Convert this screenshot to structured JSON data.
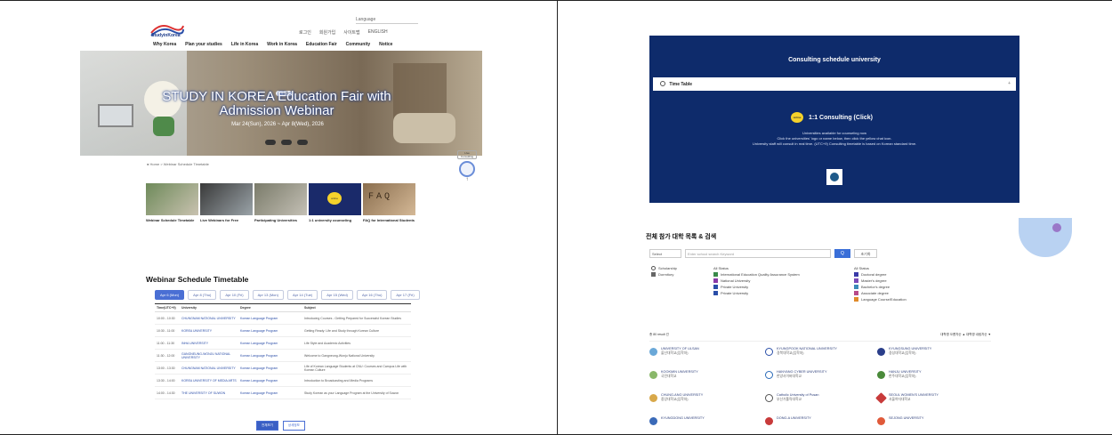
{
  "left": {
    "logo_text": "StudyinKorea",
    "lang_label": "Language",
    "util_links": [
      "로그인",
      "회원가입",
      "사이트맵",
      "ENGLISH"
    ],
    "gnb": [
      "Why Korea",
      "Plan your studies",
      "Life in Korea",
      "Work in Korea",
      "Education Fair",
      "Community",
      "Notice"
    ],
    "hero": {
      "badge": "● 알림",
      "title": "STUDY IN KOREA Education Fair with Admission Webinar",
      "date": "Mar 24(Sun), 2026 ~ Apr 8(Wed), 2026"
    },
    "breadcrumb": "Home  >  Webinar Schedule Timetable",
    "side_widget": {
      "label": "Live Consulting",
      "up": "↑"
    },
    "cards": [
      {
        "caption": "Webinar Schedule Timetable"
      },
      {
        "caption": "Live Webinars for Free"
      },
      {
        "caption": "Participating Universities"
      },
      {
        "caption": "1:1 university counseling",
        "badge": "online"
      },
      {
        "caption": "FAQ for International Students",
        "faq": "FAQ"
      }
    ],
    "section_title": "Webinar Schedule Timetable",
    "date_tabs": [
      "Apr 6 (Mon)",
      "Apr 8 (Thu)",
      "Apr 10 (Fri)",
      "Apr 13 (Mon)",
      "Apr 14 (Tue)",
      "Apr 15 (Wed)",
      "Apr 16 (Thu)",
      "Apr 17 (Fri)"
    ],
    "table": {
      "headers": [
        "Time(UTC+9)",
        "University",
        "Degree",
        "Subject"
      ],
      "rows": [
        [
          "10:00 - 10:30",
          "CHUNGNAM NATIONAL UNIVERSITY",
          "Korean Language Program",
          "Introducing Courses - Getting Prepared for Successful Korean Studies"
        ],
        [
          "10:30 - 11:00",
          "KOREA UNIVERSITY",
          "Korean Language Program",
          "Getting Ready: Life and Study through Korean Culture"
        ],
        [
          "11:00 - 11:30",
          "INHA UNIVERSITY",
          "Korean Language Program",
          "Life Style and Academic Activities"
        ],
        [
          "11:30 - 12:00",
          "GANGNEUNG-WONJU NATIONAL UNIVERSITY",
          "Korean Language Program",
          "Welcome to Gangneung-Wonju National University"
        ],
        [
          "13:00 - 13:30",
          "CHUNGNAM NATIONAL UNIVERSITY",
          "Korean Language Program",
          "Life of Korean Language Students at CNU: Courses and Campus Life with Korean Culture"
        ],
        [
          "13:30 - 14:00",
          "KOREA UNIVERSITY OF MEDIA ARTS",
          "Korean Language Program",
          "Introduction to Broadcasting and Media Programs"
        ],
        [
          "14:00 - 14:30",
          "THE UNIVERSITY OF SUWON",
          "Korean Language Program",
          "Study Korean as your Language Program at the University of Suwon"
        ]
      ]
    },
    "table_buttons": [
      "전체보기",
      "상세정보"
    ]
  },
  "right": {
    "consult_title": "Consulting schedule university",
    "timetable_label": "Time Table",
    "consult_button": "1:1 Consulting (Click)",
    "consult_bubble": "online",
    "consult_desc": [
      "Universities available for counseling now",
      "Click the universities' logo or name below, then click the yellow chat icon.",
      "University staff will consult in real time. (UTC+9) Consulting timetable is based on Korean standard time."
    ],
    "list_title": "전체 참가 대학 목록 & 검색",
    "search": {
      "select": "Select",
      "placeholder": "Enter school search Keyword",
      "button": "Q",
      "reset": "초기화"
    },
    "filters": {
      "col1": [
        "Scholarship",
        "Dormitory"
      ],
      "col2": [
        "All Status",
        "International Education Quality Assurance System",
        "National University",
        "Private University",
        "Private University"
      ],
      "col3": [
        "All Status",
        "Doctoral degree",
        "Master's degree",
        "Bachelor's degree",
        "Associate degree",
        "Language Course/Education"
      ]
    },
    "count_label": "총 80 result 건",
    "sort_options": "대학명 오름차순 ▲   대학명 내림차순 ▼",
    "universities": [
      {
        "en": "UNIVERSITY OF ULSAN",
        "kr": "울산대학교(입학처)"
      },
      {
        "en": "KYUNGPOOK NATIONAL UNIVERSITY",
        "kr": "경북대학교(입학처)"
      },
      {
        "en": "KYUNGSUNG UNIVERSITY",
        "kr": "경성대학교(입학처)"
      },
      {
        "en": "KOOKMIN UNIVERSITY",
        "kr": "국민대학교"
      },
      {
        "en": "HANYANG CYBER UNIVERSITY",
        "kr": "한양사이버대학교"
      },
      {
        "en": "HANJU UNIVERSITY",
        "kr": "한주대학교(입학처)"
      },
      {
        "en": "CHUNG-ANG UNIVERSITY",
        "kr": "중앙대학교(입학처)"
      },
      {
        "en": "Catholic University of Pusan",
        "kr": "부산가톨릭대학교"
      },
      {
        "en": "SEOUL WOMEN'S UNIVERSITY",
        "kr": "서울여자대학교"
      },
      {
        "en": "KYUNGDONG UNIVERSITY",
        "kr": ""
      },
      {
        "en": "DONG-A UNIVERSITY",
        "kr": ""
      },
      {
        "en": "SEJONG UNIVERSITY",
        "kr": ""
      }
    ],
    "colors": {
      "navy": "#0e2b6b",
      "accent": "#3a6fd8",
      "yellow": "#f5d22b"
    }
  }
}
